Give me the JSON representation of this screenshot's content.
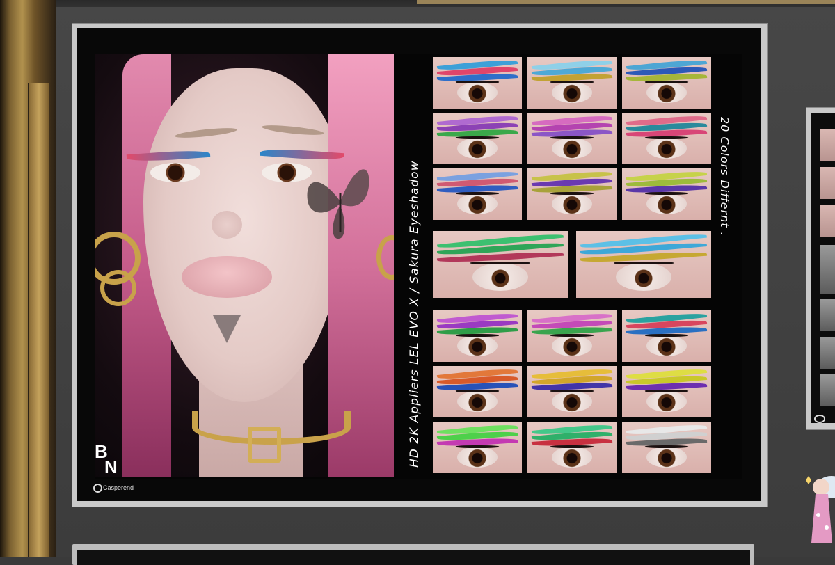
{
  "poster": {
    "title_vertical": "HD 2K Appliers LEL EVO X / Sakura Eyeshadow",
    "subtitle_vertical": "20 Colors Differnt .",
    "brand_logo_top": "B",
    "brand_logo_bottom": "N",
    "vendor_logo": "Casperend"
  },
  "swatches": [
    {
      "c1": "#e0456a",
      "c2": "#2f6fc9",
      "c3": "#3da0d8"
    },
    {
      "c1": "#4ea9d6",
      "c2": "#c2a234",
      "c3": "#8fd0e8"
    },
    {
      "c1": "#2d59b8",
      "c2": "#a6b63a",
      "c3": "#4ea6d4"
    },
    {
      "c1": "#8c42b5",
      "c2": "#3aa84a",
      "c3": "#b06ad0"
    },
    {
      "c1": "#b443b0",
      "c2": "#8b56c6",
      "c3": "#d66bc0"
    },
    {
      "c1": "#2a8a9c",
      "c2": "#d84677",
      "c3": "#e06b8a"
    },
    {
      "c1": "#d05a72",
      "c2": "#2f5dc0",
      "c3": "#7aa1e0"
    },
    {
      "c1": "#6a3ab0",
      "c2": "#a8a23a",
      "c3": "#c7c24a"
    },
    {
      "c1": "#9dbb3c",
      "c2": "#5a37a8",
      "c3": "#c6d24a"
    },
    {
      "c1": "#2fa558",
      "c2": "#b2385a",
      "c3": "#3cc070"
    },
    {
      "c1": "#3ea8d8",
      "c2": "#c6a833",
      "c3": "#5cc0e6"
    },
    {
      "c1": "#9a3ac2",
      "c2": "#2f9d48",
      "c3": "#c05ad0"
    },
    {
      "c1": "#c44ab8",
      "c2": "#3aa44e",
      "c3": "#d870c8"
    },
    {
      "c1": "#d8465e",
      "c2": "#2a70c2",
      "c3": "#2aa2a0"
    },
    {
      "c1": "#d85a2a",
      "c2": "#2852b8",
      "c3": "#e2783a"
    },
    {
      "c1": "#d2a62a",
      "c2": "#4234a8",
      "c3": "#e6bd3a"
    },
    {
      "c1": "#c9c82a",
      "c2": "#6d2fb0",
      "c3": "#dedd44"
    },
    {
      "c1": "#4ed04a",
      "c2": "#c43ab2",
      "c3": "#6ee060"
    },
    {
      "c1": "#2fb06a",
      "c2": "#c83040",
      "c3": "#44c88a"
    },
    {
      "c1": "#d0d0d0",
      "c2": "#6a6a6a",
      "c3": "#e8e8e8"
    }
  ]
}
